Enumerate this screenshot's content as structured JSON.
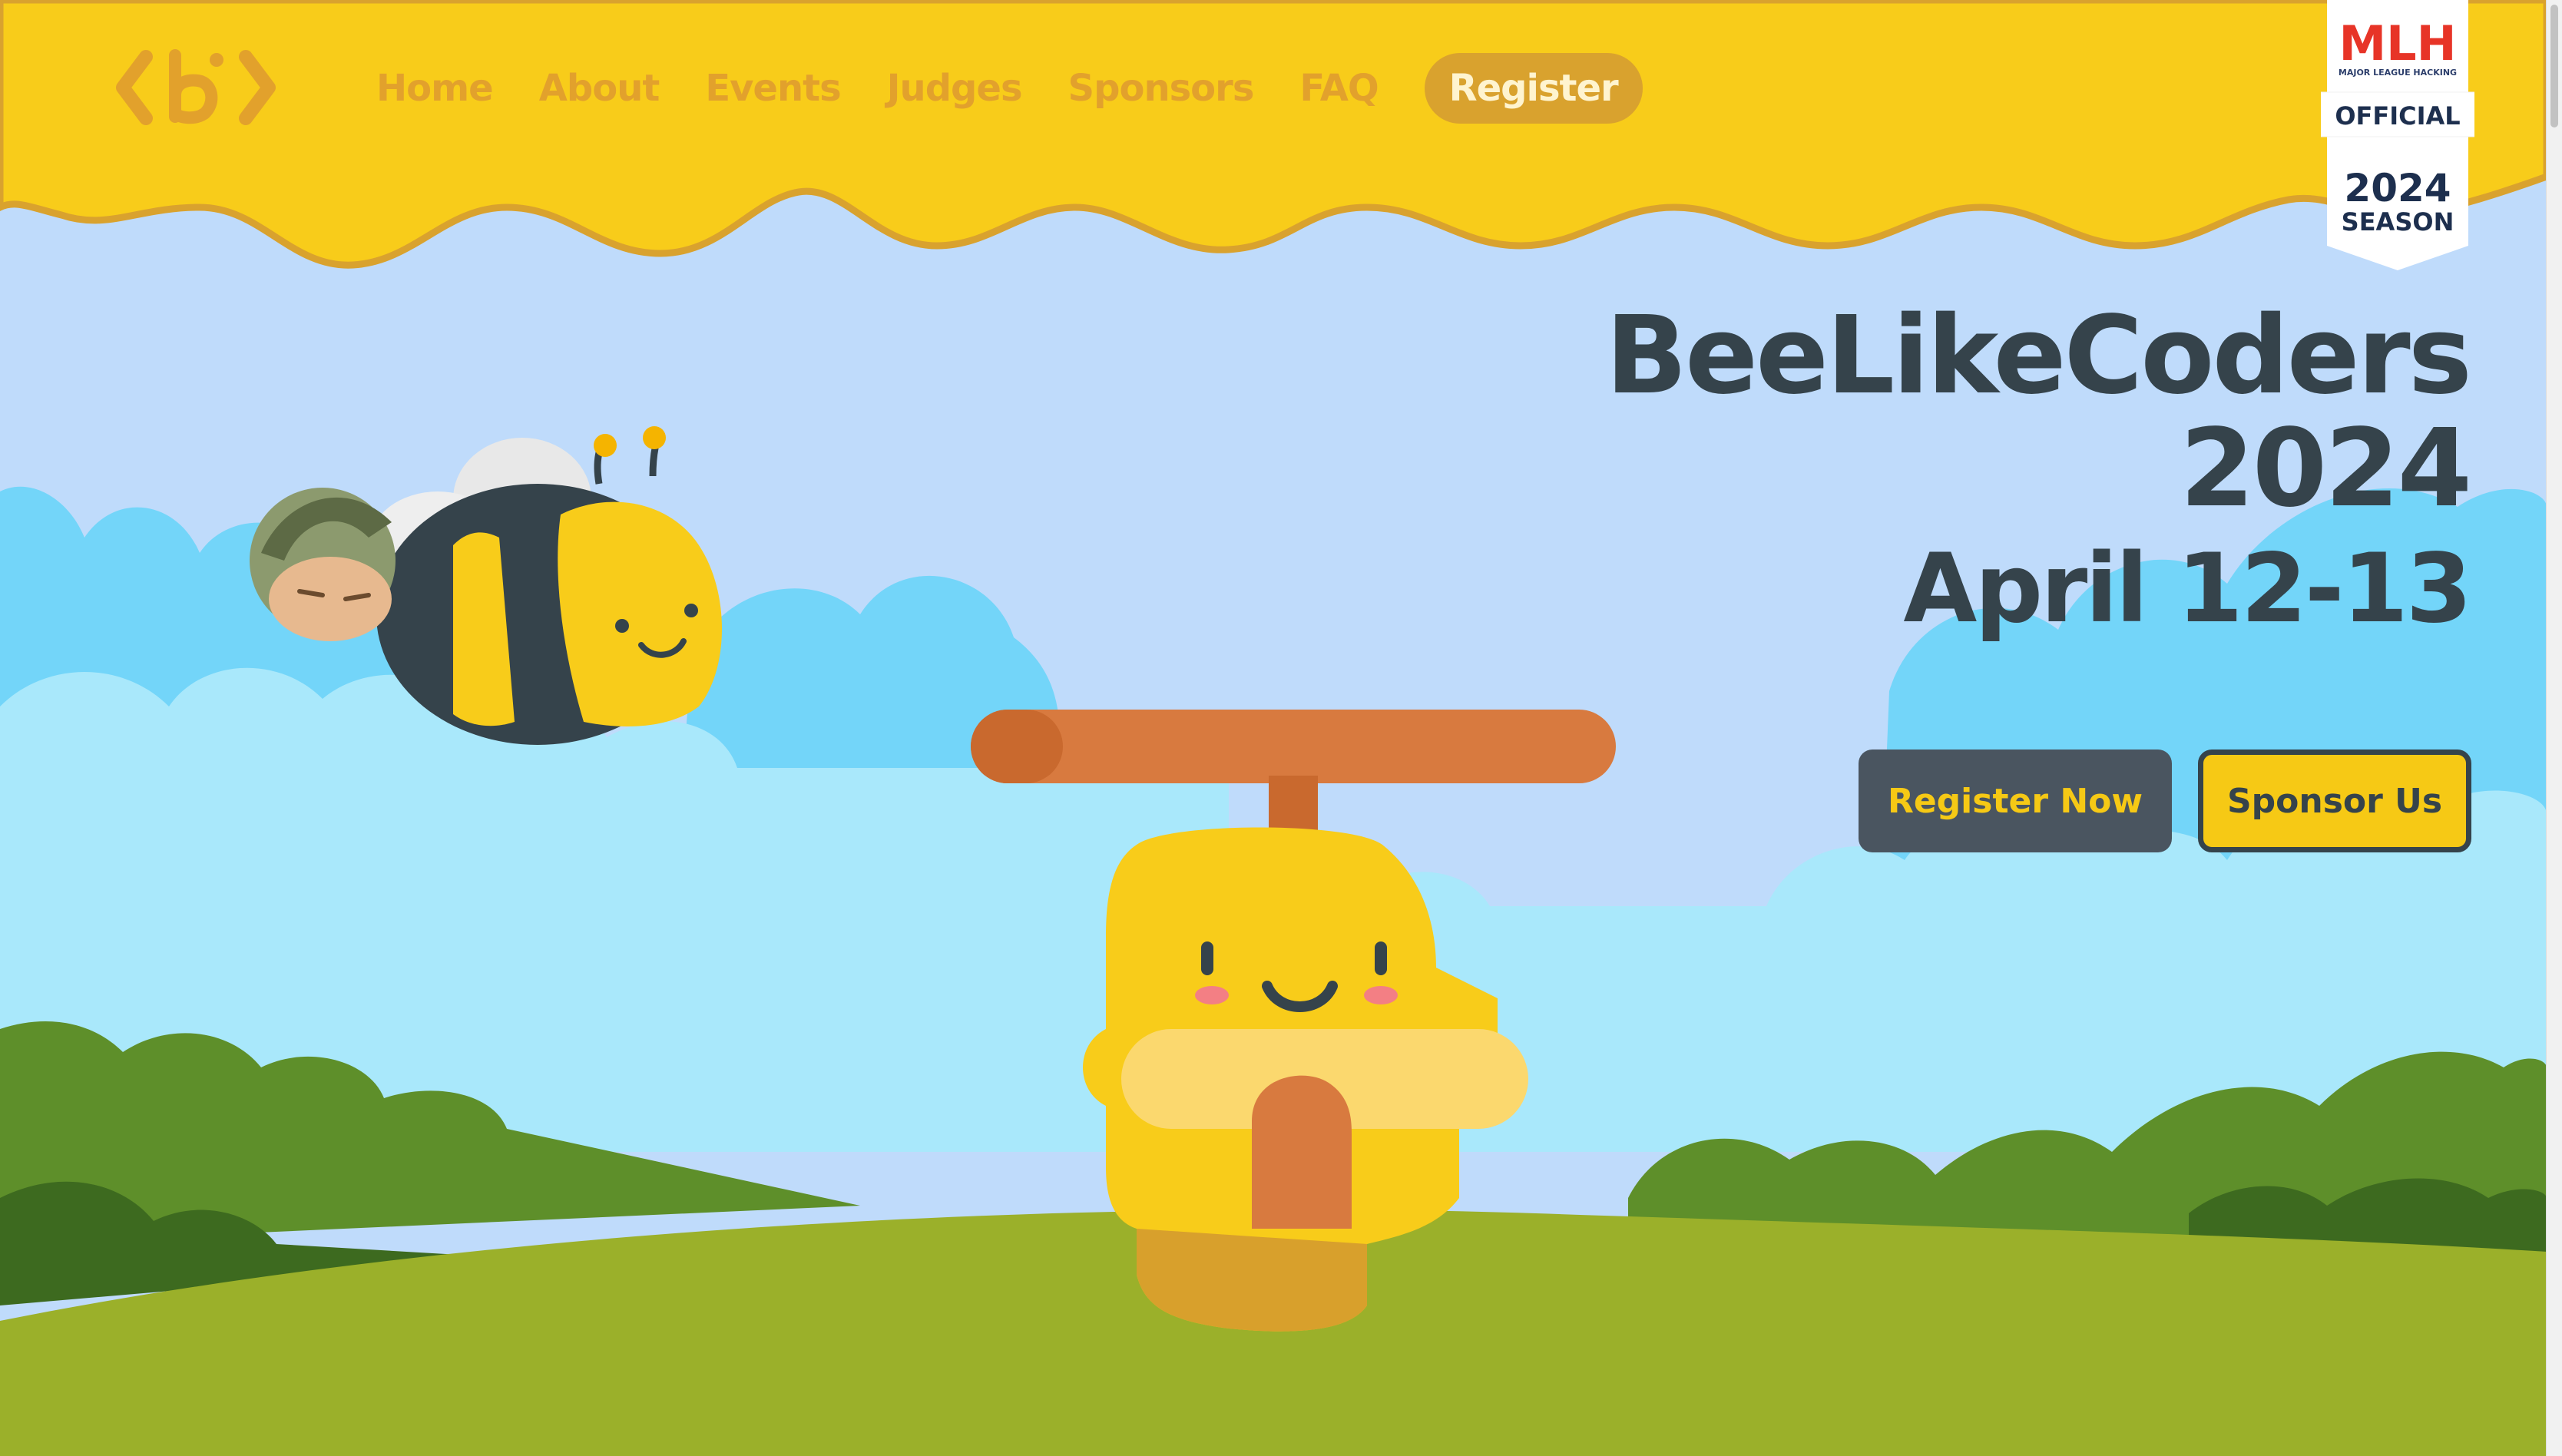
{
  "nav": {
    "items": [
      {
        "label": "Home"
      },
      {
        "label": "About"
      },
      {
        "label": "Events"
      },
      {
        "label": "Judges"
      },
      {
        "label": "Sponsors"
      },
      {
        "label": "FAQ"
      }
    ],
    "register_label": "Register"
  },
  "logo": {
    "glyph_left": "<",
    "glyph_mid": "b",
    "glyph_right": ">"
  },
  "mlh": {
    "brand": "MLH",
    "subtitle": "MAJOR LEAGUE HACKING",
    "official": "OFFICIAL",
    "year": "2024",
    "season": "SEASON"
  },
  "hero": {
    "title_line1": "BeeLikeCoders",
    "title_line2": "2024",
    "date": "April 12-13"
  },
  "cta": {
    "register_label": "Register Now",
    "sponsor_label": "Sponsor Us"
  },
  "colors": {
    "honey": "#f8cc1a",
    "honey_drip_edge": "#d9a22e",
    "sky": "#bfdbfb",
    "dark_text": "#35434b",
    "grass": "#9bb02a"
  }
}
